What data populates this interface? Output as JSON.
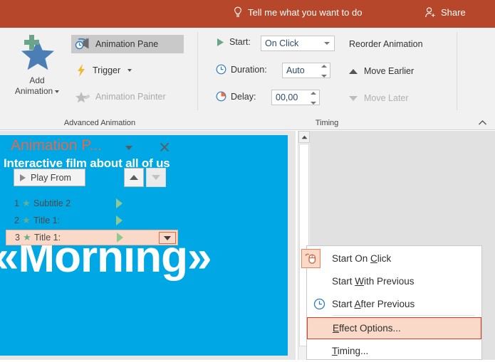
{
  "titlebar": {
    "tell_me": "Tell me what you want to do",
    "share": "Share",
    "bg_color": "#b7472a"
  },
  "ribbon": {
    "groups": [
      {
        "label": "Advanced Animation"
      },
      {
        "label": "Timing"
      }
    ],
    "add_animation": {
      "line1": "Add",
      "line2": "Animation",
      "icon": "star-plus-icon"
    },
    "animation_pane": {
      "label": "Animation Pane",
      "icon": "animation-pane-icon",
      "state": "active"
    },
    "trigger": {
      "label": "Trigger",
      "icon": "lightning-bolt-icon"
    },
    "animation_painter": {
      "label": "Animation Painter",
      "icon": "animation-painter-icon",
      "state": "disabled"
    },
    "timing": {
      "start_label": "Start:",
      "start_value": "On Click",
      "duration_label": "Duration:",
      "duration_value": "Auto",
      "delay_label": "Delay:",
      "delay_value": "00,00",
      "reorder_label": "Reorder Animation",
      "move_earlier": "Move Earlier",
      "move_later": "Move Later"
    }
  },
  "slide": {
    "subtitle": "Interactive film about all of us",
    "title": "«Morning»",
    "bg_color": "#00a7e5"
  },
  "anim_pane": {
    "title": "Animation P...",
    "play_from": "Play From",
    "accent_color": "#e8674a",
    "items": [
      {
        "num": "1",
        "name": "Subtitle 2"
      },
      {
        "num": "2",
        "name": "Title 1:"
      },
      {
        "num": "3",
        "name": "Title 1:"
      }
    ]
  },
  "context_menu": {
    "items": [
      {
        "pre": "Start On ",
        "key": "C",
        "post": "lick",
        "icon": "mouse-click-icon"
      },
      {
        "pre": "Start ",
        "key": "W",
        "post": "ith Previous",
        "icon": "none"
      },
      {
        "pre": "Start ",
        "key": "A",
        "post": "fter Previous",
        "icon": "clock-icon"
      },
      {
        "pre": "",
        "key": "E",
        "post": "ffect Options...",
        "icon": "none"
      },
      {
        "pre": "",
        "key": "T",
        "post": "iming...",
        "icon": "none"
      }
    ],
    "highlight_color": "#e03a24"
  }
}
